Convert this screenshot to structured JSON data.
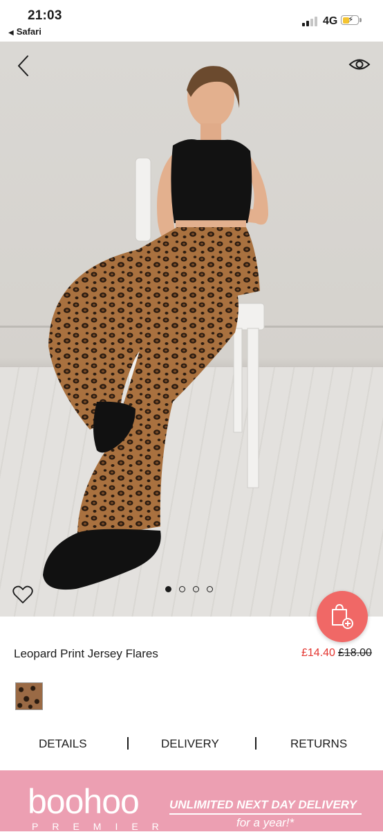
{
  "status_bar": {
    "time": "21:03",
    "back_app": "Safari",
    "network": "4G",
    "battery_charging": true
  },
  "hero": {
    "image_count": 4,
    "active_image": 1
  },
  "product": {
    "title": "Leopard Print Jersey Flares",
    "price": "£14.40",
    "original_price": "£18.00"
  },
  "tabs": [
    {
      "label": "DETAILS"
    },
    {
      "label": "DELIVERY"
    },
    {
      "label": "RETURNS"
    }
  ],
  "banner": {
    "brand": "boohoo",
    "brand_sub": "PREMIER",
    "promo": "UNLIMITED NEXT DAY DELIVERY",
    "promo_sub": "for a year!*"
  },
  "colors": {
    "accent": "#f06866",
    "price": "#e3342f",
    "banner": "#ec9fb2"
  },
  "icons": [
    "back-arrow-icon",
    "eye-icon",
    "heart-icon",
    "add-to-bag-icon"
  ]
}
